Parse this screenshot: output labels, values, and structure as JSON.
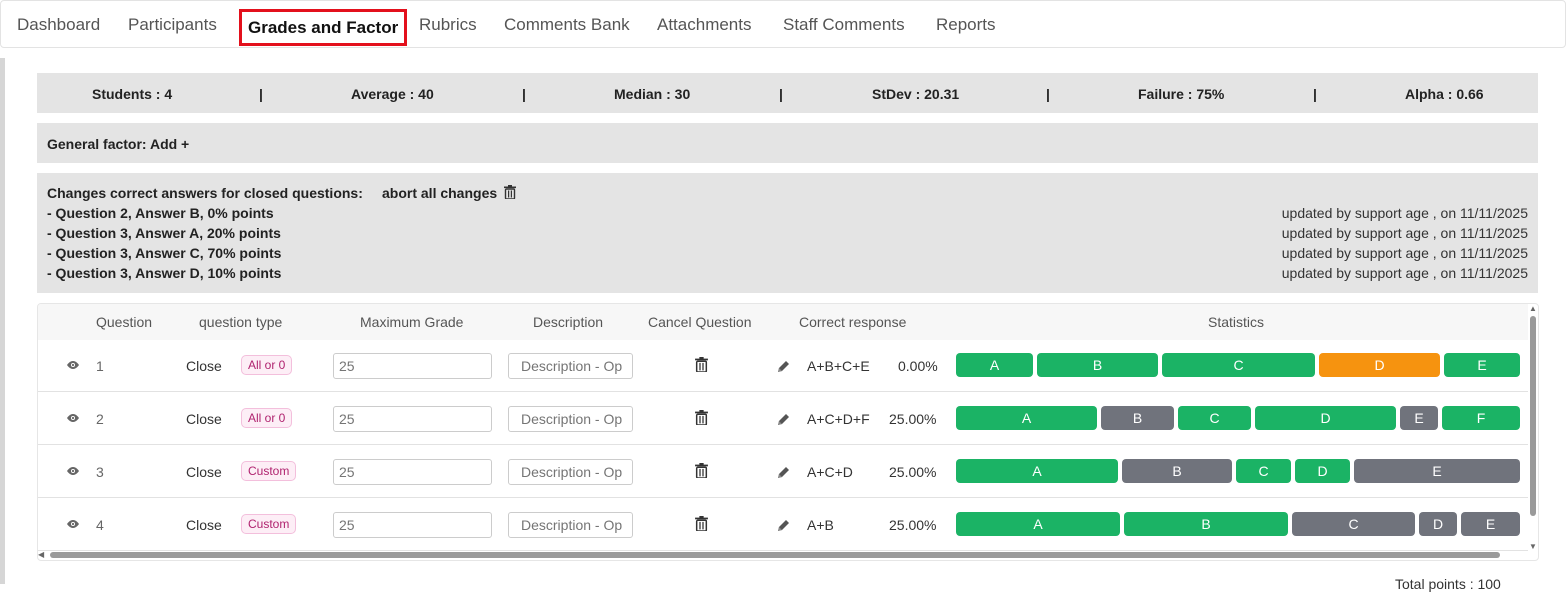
{
  "nav": {
    "tabs": [
      "Dashboard",
      "Participants",
      "Grades and Factor",
      "Rubrics",
      "Comments Bank",
      "Attachments",
      "Staff Comments",
      "Reports"
    ]
  },
  "stats": {
    "students": "Students : 4",
    "average": "Average : 40",
    "median": "Median : 30",
    "stdev": "StDev : 20.31",
    "failure": "Failure : 75%",
    "alpha": "Alpha : 0.66",
    "separator": "|"
  },
  "general_factor": "General factor: Add +",
  "changes": {
    "title": "Changes correct answers for closed questions:",
    "abort_label": "abort all changes",
    "items": [
      {
        "text": "- Question 2, Answer B, 0% points",
        "updated": "updated by support age , on 11/11/2025"
      },
      {
        "text": "- Question 3, Answer A, 20% points",
        "updated": "updated by support age , on 11/11/2025"
      },
      {
        "text": "- Question 3, Answer C, 70% points",
        "updated": "updated by support age , on 11/11/2025"
      },
      {
        "text": "- Question 3, Answer D, 10% points",
        "updated": "updated by support age , on 11/11/2025"
      }
    ]
  },
  "table": {
    "headers": [
      "Question",
      "question type",
      "Maximum Grade",
      "Description",
      "Cancel Question",
      "Correct response",
      "Statistics"
    ],
    "description_placeholder": "Description - Op",
    "rows": [
      {
        "number": "1",
        "type": "Close",
        "scoring": "All or 0",
        "max_grade": "25",
        "correct": "A+B+C+E",
        "percent": "0.00%",
        "stats": [
          {
            "label": "A",
            "share": 0.14,
            "color": "green"
          },
          {
            "label": "B",
            "share": 0.22,
            "color": "green"
          },
          {
            "label": "C",
            "share": 0.28,
            "color": "green"
          },
          {
            "label": "D",
            "share": 0.22,
            "color": "orange"
          },
          {
            "label": "E",
            "share": 0.14,
            "color": "green"
          }
        ]
      },
      {
        "number": "2",
        "type": "Close",
        "scoring": "All or 0",
        "max_grade": "25",
        "correct": "A+C+D+F",
        "percent": "25.00%",
        "stats": [
          {
            "label": "A",
            "share": 0.26,
            "color": "green"
          },
          {
            "label": "B",
            "share": 0.135,
            "color": "grey"
          },
          {
            "label": "C",
            "share": 0.135,
            "color": "green"
          },
          {
            "label": "D",
            "share": 0.26,
            "color": "green"
          },
          {
            "label": "E",
            "share": 0.07,
            "color": "grey"
          },
          {
            "label": "F",
            "share": 0.14,
            "color": "green"
          }
        ]
      },
      {
        "number": "3",
        "type": "Close",
        "scoring": "Custom",
        "max_grade": "25",
        "correct": "A+C+D",
        "percent": "25.00%",
        "stats": [
          {
            "label": "A",
            "share": 0.295,
            "color": "green"
          },
          {
            "label": "B",
            "share": 0.2,
            "color": "grey"
          },
          {
            "label": "C",
            "share": 0.1,
            "color": "green"
          },
          {
            "label": "D",
            "share": 0.1,
            "color": "green"
          },
          {
            "label": "E",
            "share": 0.305,
            "color": "grey"
          }
        ]
      },
      {
        "number": "4",
        "type": "Close",
        "scoring": "Custom",
        "max_grade": "25",
        "correct": "A+B",
        "percent": "25.00%",
        "stats": [
          {
            "label": "A",
            "share": 0.3,
            "color": "green"
          },
          {
            "label": "B",
            "share": 0.3,
            "color": "green"
          },
          {
            "label": "C",
            "share": 0.225,
            "color": "grey"
          },
          {
            "label": "D",
            "share": 0.07,
            "color": "grey"
          },
          {
            "label": "E",
            "share": 0.07,
            "color": "grey"
          }
        ]
      }
    ]
  },
  "total_points": "Total points : 100",
  "colors": {
    "green": "#1bb365",
    "orange": "#f6930f",
    "grey": "#70737c",
    "active_outline": "#e3101c"
  }
}
